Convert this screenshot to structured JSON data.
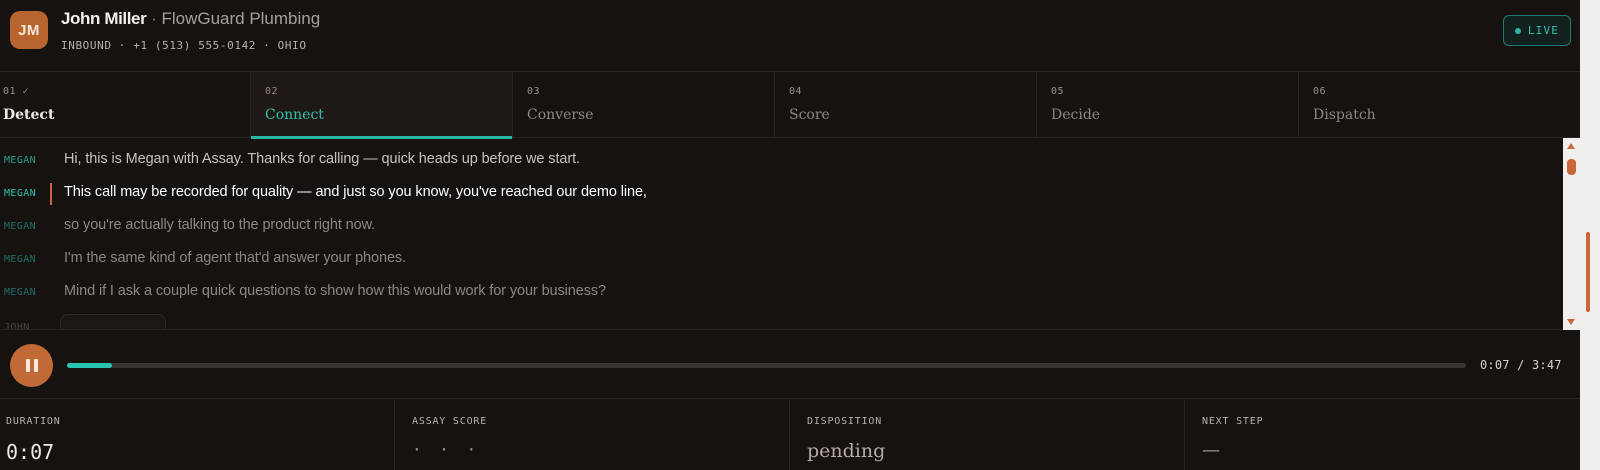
{
  "header": {
    "avatar_initials": "JM",
    "caller_name": "John Miller",
    "separator": " · ",
    "company": "FlowGuard Plumbing",
    "meta": "INBOUND · +1 (513) 555-0142 · OHIO",
    "live_label": "LIVE"
  },
  "steps": [
    {
      "num": "01 ✓",
      "label": "Detect",
      "state": "done"
    },
    {
      "num": "02",
      "label": "Connect",
      "state": "active"
    },
    {
      "num": "03",
      "label": "Converse",
      "state": "pending"
    },
    {
      "num": "04",
      "label": "Score",
      "state": "pending"
    },
    {
      "num": "05",
      "label": "Decide",
      "state": "pending"
    },
    {
      "num": "06",
      "label": "Dispatch",
      "state": "pending"
    }
  ],
  "transcript": [
    {
      "speaker": "MEGAN",
      "text": "Hi, this is Megan with Assay. Thanks for calling — quick heads up before we start.",
      "state": "past"
    },
    {
      "speaker": "MEGAN",
      "text": "This call may be recorded for quality — and just so you know, you've reached our demo line,",
      "state": "current"
    },
    {
      "speaker": "MEGAN",
      "text": "so you're actually talking to the product right now.",
      "state": "upcoming"
    },
    {
      "speaker": "MEGAN",
      "text": "I'm the same kind of agent that'd answer your phones.",
      "state": "upcoming"
    },
    {
      "speaker": "MEGAN",
      "text": "Mind if I ask a couple quick questions to show how this would work for your business?",
      "state": "upcoming"
    },
    {
      "speaker": "JOHN",
      "text": "",
      "state": "upcoming"
    }
  ],
  "player": {
    "progress_fraction": 0.0323,
    "time_readout": "0:07 / 3:47"
  },
  "stats": {
    "duration_label": "DURATION",
    "duration_value": "0:07",
    "score_label": "ASSAY SCORE",
    "score_value": "· · ·",
    "disposition_label": "DISPOSITION",
    "disposition_value": "pending",
    "next_label": "NEXT STEP",
    "next_value": "—"
  },
  "colors": {
    "accent_teal": "#27b7a8",
    "accent_orange": "#c06a37",
    "background": "#161210"
  }
}
